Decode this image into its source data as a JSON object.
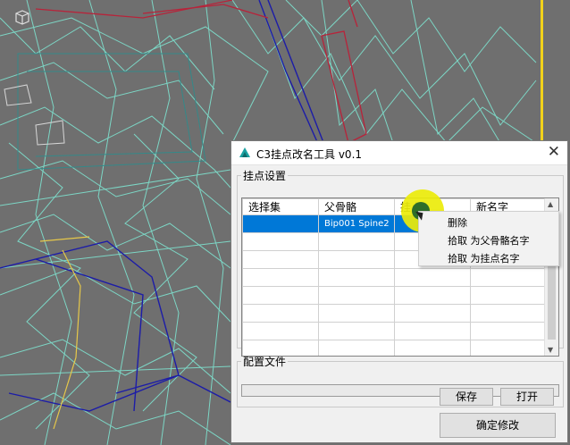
{
  "dialog": {
    "title": "C3挂点改名工具 v0.1",
    "close_glyph": "✕"
  },
  "points_group": {
    "legend": "挂点设置",
    "columns": [
      "选择集",
      "父骨骼",
      "挂点",
      "新名字"
    ],
    "selected_row": [
      "",
      "Bip001 Spine2",
      "",
      ""
    ]
  },
  "context_menu": {
    "items": [
      "删除",
      "拾取 为父骨骼名字",
      "拾取 为挂点名字"
    ]
  },
  "config_group": {
    "legend": "配置文件",
    "file_path": ""
  },
  "buttons": {
    "save": "保存",
    "open": "打开",
    "confirm": "确定修改"
  },
  "colors": {
    "selection": "#0078d7",
    "viewport_bg": "#6f6f6f",
    "wire_cyan": "#7fe8d4",
    "wire_blue": "#1c1ca8",
    "wire_red": "#b8233a",
    "cursor_highlight": "#ebeb0a"
  }
}
